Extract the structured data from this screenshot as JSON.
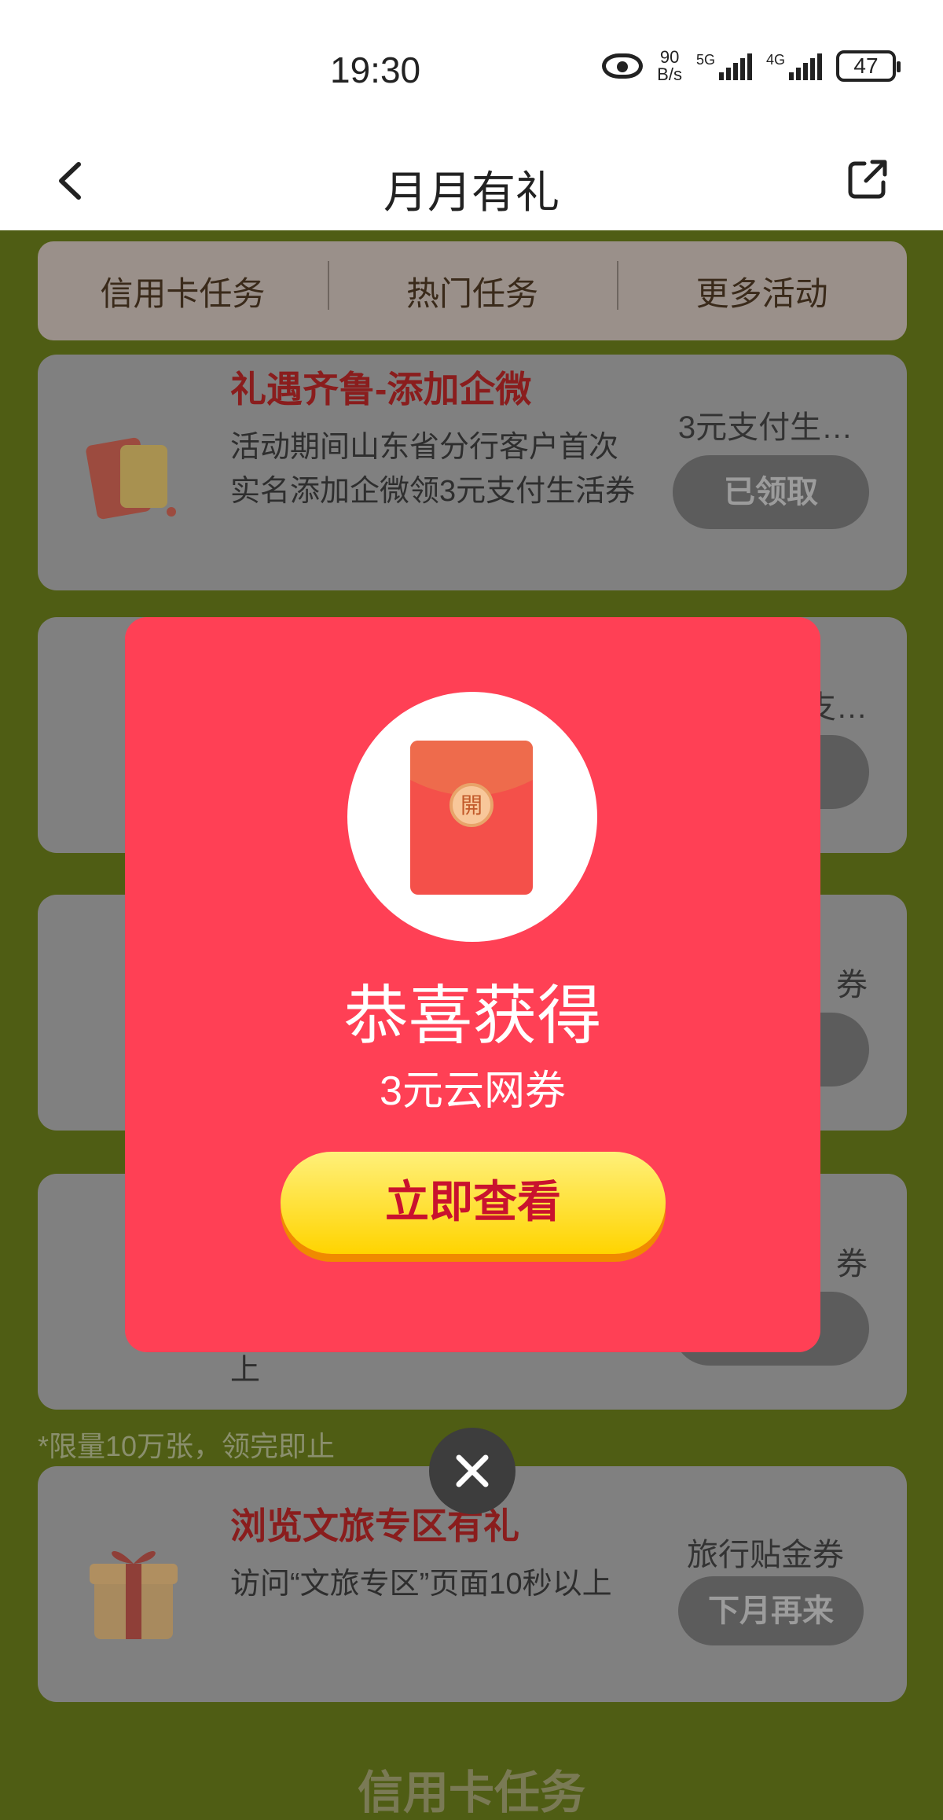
{
  "status_bar": {
    "time": "19:30",
    "net_speed_value": "90",
    "net_speed_unit": "B/s",
    "signal1_label": "5G",
    "signal2_label": "4G",
    "battery": "47"
  },
  "header": {
    "title": "月月有礼"
  },
  "tabs": [
    {
      "label": "信用卡任务"
    },
    {
      "label": "热门任务"
    },
    {
      "label": "更多活动"
    }
  ],
  "cards": [
    {
      "title": "礼遇齐鲁-添加企微",
      "description": "活动期间山东省分行客户首次实名添加企微领3元支付生活券",
      "reward": "3元支付生…",
      "button": "已领取"
    },
    {
      "reward": "支…"
    },
    {
      "reward": "券"
    },
    {
      "reward": "券",
      "description_tail": "上"
    },
    {
      "title": "浏览文旅专区有礼",
      "description": "访问“文旅专区”页面10秒以上",
      "reward": "旅行贴金券",
      "button": "下月再来"
    }
  ],
  "limit_note": "*限量10万张，领完即止",
  "section_title": "信用卡任务",
  "modal": {
    "envelope_char": "開",
    "title": "恭喜获得",
    "subtitle": "3元云网券",
    "button": "立即查看"
  },
  "icons": [
    "back-icon",
    "share-icon",
    "eye-icon",
    "red-envelope-icon",
    "close-icon",
    "gift-icon",
    "card-icon"
  ]
}
